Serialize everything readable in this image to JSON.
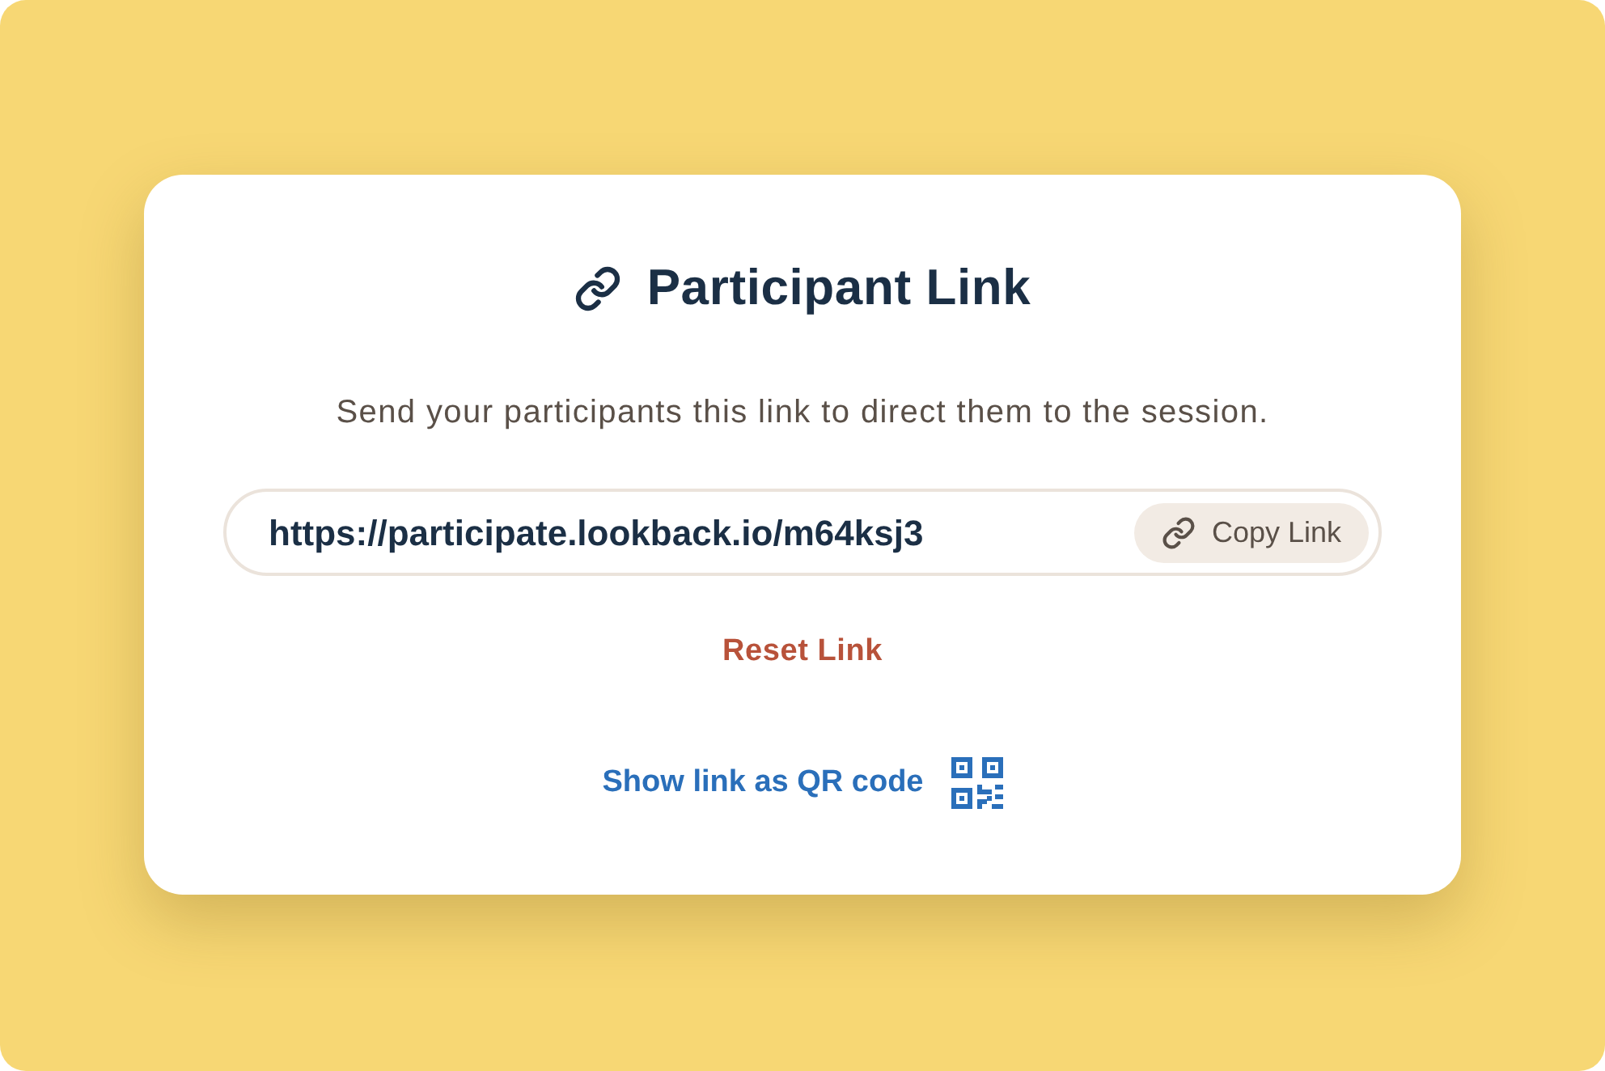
{
  "card": {
    "title": "Participant Link",
    "description": "Send your participants this link to direct them to the session.",
    "link_field": {
      "value": "https://participate.lookback.io/m64ksj3"
    },
    "copy_button": {
      "label": "Copy Link"
    },
    "reset_link": {
      "label": "Reset Link"
    },
    "qr_link": {
      "label": "Show link as QR code"
    }
  }
}
